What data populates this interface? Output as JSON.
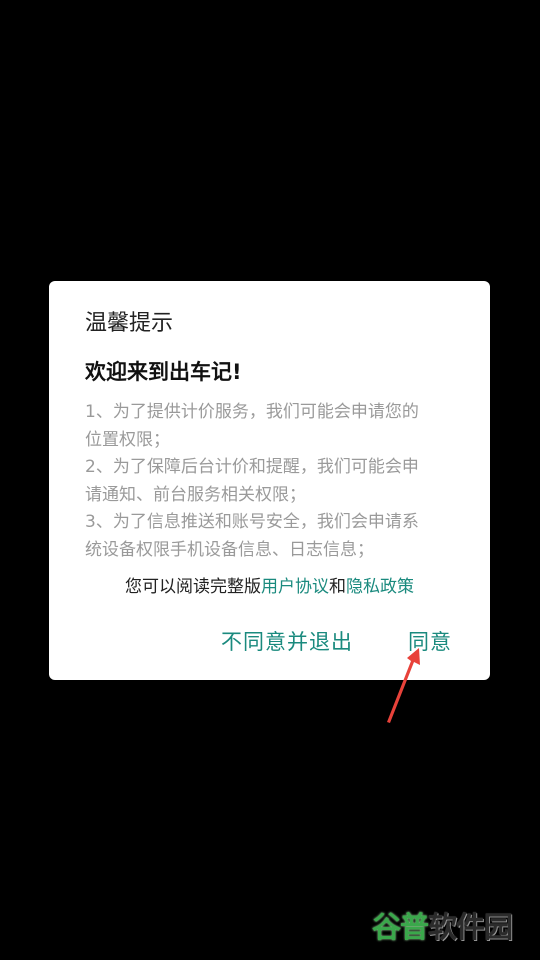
{
  "dialog": {
    "title": "温馨提示",
    "heading": "欢迎来到出车记!",
    "body_lines": [
      "1、为了提供计价服务，我们可能会申请您的",
      "位置权限；",
      "2、为了保障后台计价和提醒，我们可能会申",
      "请通知、前台服务相关权限；",
      "3、为了信息推送和账号安全，我们会申请系",
      "统设备权限手机设备信息、日志信息；"
    ],
    "read_prefix": "您可以阅读完整版",
    "user_agreement_link": "用户协议",
    "read_and": "和",
    "privacy_policy_link": "隐私政策",
    "decline_label": "不同意并退出",
    "agree_label": "同意"
  },
  "watermark": {
    "brand": "谷普",
    "rest": "软件园"
  },
  "colors": {
    "accent": "#1a8a7e",
    "arrow": "#e8423a",
    "backdrop": "#000000",
    "watermark_green": "#3aa84b"
  },
  "icons": {
    "annotation": "red-arrow-icon"
  }
}
